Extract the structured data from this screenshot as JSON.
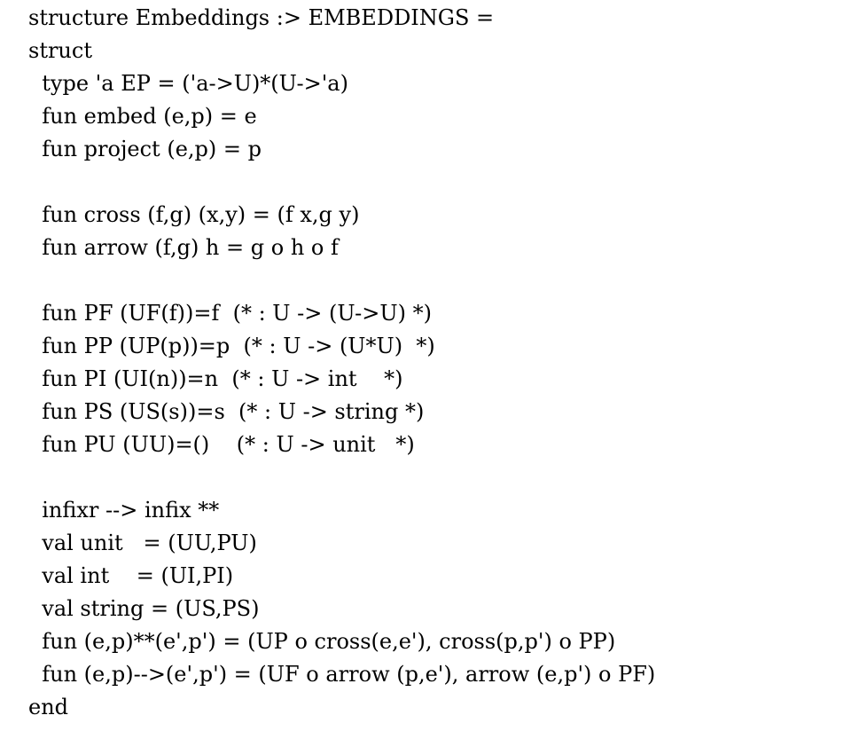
{
  "lines": [
    "structure Embeddings :> EMBEDDINGS =",
    "struct",
    "  type 'a EP = ('a->U)*(U->'a)",
    "  fun embed (e,p) = e",
    "  fun project (e,p) = p",
    "",
    "  fun cross (f,g) (x,y) = (f x,g y)",
    "  fun arrow (f,g) h = g o h o f",
    "",
    "  fun PF (UF(f))=f  (* : U -> (U->U) *)",
    "  fun PP (UP(p))=p  (* : U -> (U*U)  *)",
    "  fun PI (UI(n))=n  (* : U -> int    *)",
    "  fun PS (US(s))=s  (* : U -> string *)",
    "  fun PU (UU)=()    (* : U -> unit   *)",
    "",
    "  infixr --> infix **",
    "  val unit   = (UU,PU)",
    "  val int    = (UI,PI)",
    "  val string = (US,PS)",
    "  fun (e,p)**(e',p') = (UP o cross(e,e'), cross(p,p') o PP)",
    "  fun (e,p)-->(e',p') = (UF o arrow (p,e'), arrow (e,p') o PF)",
    "end"
  ]
}
